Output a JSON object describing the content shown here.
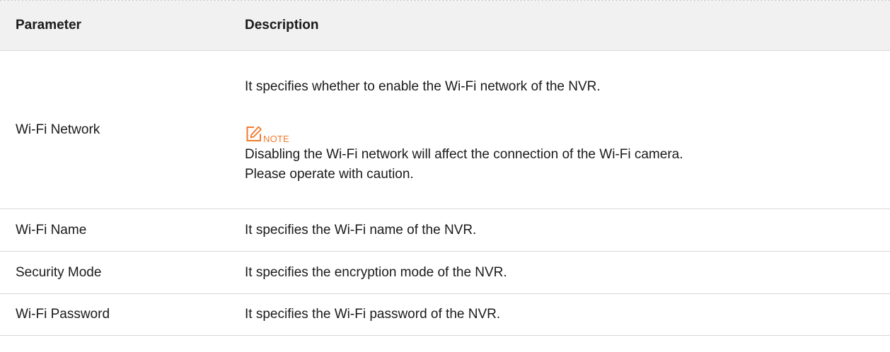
{
  "table": {
    "headers": [
      "Parameter",
      "Description"
    ],
    "rows": [
      {
        "parameter": "Wi-Fi Network",
        "description": "It specifies whether to enable the Wi-Fi network of the NVR.",
        "note": {
          "icon": "note-pencil-icon",
          "label": "NOTE",
          "color": "#f07a2c",
          "lines": [
            "Disabling the Wi-Fi network will affect the connection of the Wi-Fi camera.",
            "Please operate with caution."
          ]
        }
      },
      {
        "parameter": "Wi-Fi Name",
        "description": "It specifies the Wi-Fi name of the NVR."
      },
      {
        "parameter": "Security Mode",
        "description": "It specifies the encryption mode of the NVR."
      },
      {
        "parameter": "Wi-Fi Password",
        "description": "It specifies the Wi-Fi password of the NVR."
      }
    ]
  }
}
